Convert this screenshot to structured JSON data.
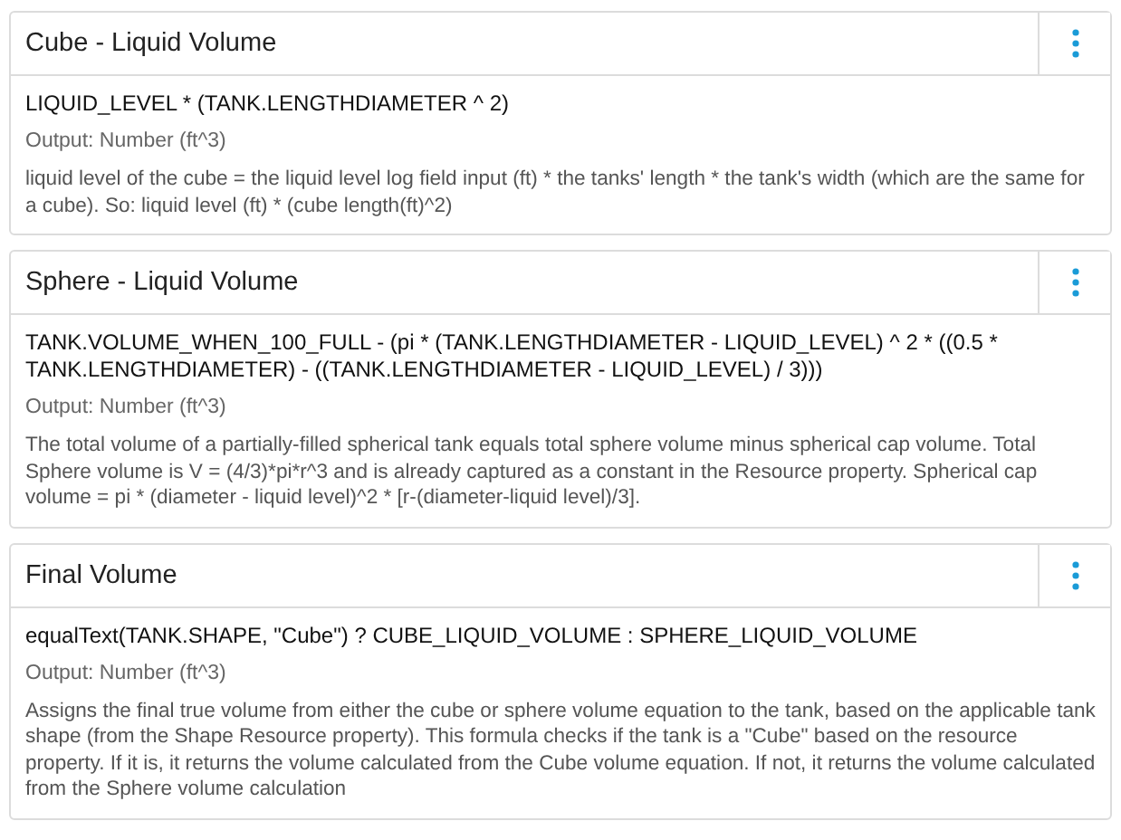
{
  "formulas": [
    {
      "title": "Cube - Liquid Volume",
      "expression": "LIQUID_LEVEL * (TANK.LENGTHDIAMETER ^ 2)",
      "output": "Output: Number (ft^3)",
      "description": "liquid level of the cube = the liquid level log field input (ft) * the tanks' length * the tank's width (which are the same for a cube). So: liquid level (ft) * (cube length(ft)^2)"
    },
    {
      "title": "Sphere - Liquid Volume",
      "expression": "TANK.VOLUME_WHEN_100_FULL - (pi * (TANK.LENGTHDIAMETER - LIQUID_LEVEL) ^ 2 * ((0.5 * TANK.LENGTHDIAMETER) - ((TANK.LENGTHDIAMETER - LIQUID_LEVEL) / 3)))",
      "output": "Output: Number (ft^3)",
      "description": "The total volume of a partially-filled spherical tank equals total sphere volume minus spherical cap volume. Total Sphere volume is V = (4/3)*pi*r^3 and is already captured as a constant in the Resource property. Spherical cap volume = pi * (diameter - liquid level)^2 * [r-(diameter-liquid level)/3]."
    },
    {
      "title": "Final Volume",
      "expression": "equalText(TANK.SHAPE, \"Cube\") ? CUBE_LIQUID_VOLUME : SPHERE_LIQUID_VOLUME",
      "output": "Output: Number (ft^3)",
      "description": "Assigns the final true volume from either the cube or sphere volume equation to the tank, based on the applicable tank shape (from the Shape Resource property). This formula checks if the tank is a \"Cube\" based on the resource property. If it is, it returns the volume calculated from the Cube volume equation. If not, it returns the volume calculated from the Sphere volume calculation"
    }
  ]
}
